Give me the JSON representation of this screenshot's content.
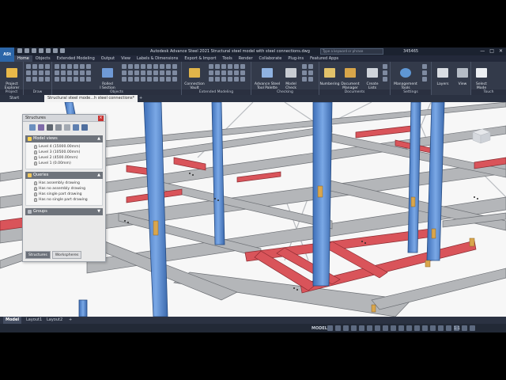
{
  "app": {
    "logo_text": "ASt",
    "window_title": "Autodesk Advance Steel 2021   Structural steel model with steel connections.dwg",
    "search_placeholder": "Type a keyword or phrase",
    "user": "345465",
    "controls": [
      "—",
      "□",
      "✕"
    ]
  },
  "ribbon_tabs": [
    "Home",
    "Objects",
    "Extended Modeling",
    "Output",
    "View",
    "Labels & Dimensions",
    "Export & Import",
    "Tools",
    "Render",
    "Collaborate",
    "Plug-ins",
    "Featured Apps"
  ],
  "ribbon_active_tab": "Home",
  "ribbon": {
    "panels": [
      "Project",
      "Draw",
      "Objects",
      "Extended Modeling",
      "Checking",
      "Documents",
      "Settings",
      "Touch"
    ],
    "buttons": {
      "project_explorer": "Project\nExplorer",
      "rolled_i_section": "Rolled\nI Section",
      "connection_vault": "Connection\nVault",
      "tool_palette": "Advance Steel\nTool Palette",
      "model_check": "Model\nCheck",
      "numbering": "Numbering",
      "document_manager": "Document\nManager",
      "create_lists": "Create\nLists",
      "management_tools": "Management\nTools",
      "layers": "Layers",
      "view": "View",
      "select_mode": "Select\nMode"
    }
  },
  "doc_tabs": [
    "Start",
    "Structural steel mode...h steel connections*",
    "+"
  ],
  "palette": {
    "title": "Structures",
    "close": "×",
    "model_views": {
      "header": "Model views",
      "items": [
        "Level 4 (15000.00mm)",
        "Level 3 (10500.00mm)",
        "Level 2 (4500.00mm)",
        "Level 1 (0.00mm)"
      ]
    },
    "queries": {
      "header": "Queries",
      "items": [
        "Has assembly drawing",
        "Has no assembly drawing",
        "Has single part drawing",
        "Has no single part drawing"
      ]
    },
    "groups": {
      "header": "Groups"
    },
    "tabs": [
      "Structures",
      "Workspheres"
    ]
  },
  "layout_tabs": [
    "Model",
    "Layout1",
    "Layout2",
    "+"
  ],
  "status": {
    "model": "MODEL",
    "scale": "1:1"
  },
  "colors": {
    "column": "#5b8fd6",
    "beam_red": "#d9545a",
    "beam_grey": "#a8aaad",
    "ribbon": "#333a4a",
    "titlebar": "#1b2230"
  }
}
